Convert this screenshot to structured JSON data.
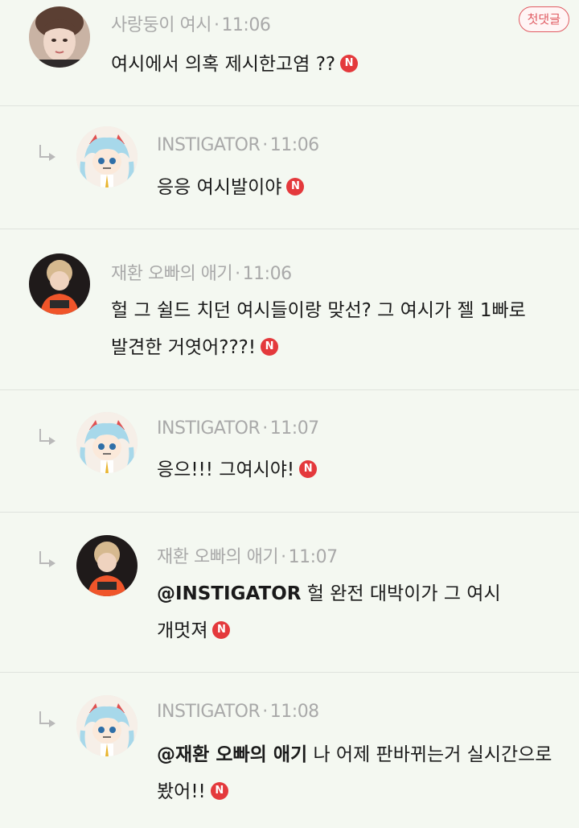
{
  "comments": [
    {
      "author": "사랑둥이 여시",
      "time": "11:06",
      "avatar": "photo-avatar-person",
      "badge": "첫댓글",
      "lines": [
        "여시에서 의혹 제시한고염 ??"
      ],
      "new_badge": "N"
    },
    {
      "author": "INSTIGATOR",
      "time": "11:06",
      "avatar": "cartoon-star-avatar",
      "lines": [
        "응응 여시발이야"
      ],
      "new_badge": "N"
    },
    {
      "author": "재환 오빠의 애기",
      "time": "11:06",
      "avatar": "photo-avatar-orange-shirt",
      "lines": [
        "헐 그 쉴드 치던 여시들이랑 맞선? 그 여시가 젤 1빠로",
        "발견한 거엿어???!"
      ],
      "new_badge": "N"
    },
    {
      "author": "INSTIGATOR",
      "time": "11:07",
      "avatar": "cartoon-star-avatar",
      "lines": [
        "응으!!! 그여시야!"
      ],
      "new_badge": "N"
    },
    {
      "author": "재환 오빠의 애기",
      "time": "11:07",
      "avatar": "photo-avatar-orange-shirt",
      "mention": "@INSTIGATOR",
      "lines": [
        " 헐 완전 대박이가 그 여시",
        "개멋져"
      ],
      "new_badge": "N"
    },
    {
      "author": "INSTIGATOR",
      "time": "11:08",
      "avatar": "cartoon-star-avatar",
      "mention": "@재환 오빠의 애기",
      "lines": [
        " 나 어제 판바뀌는거 실시간으로",
        "봤어!!"
      ],
      "new_badge": "N"
    }
  ],
  "colors": {
    "background": "#f4f8f1",
    "meta_text": "#a9a9a9",
    "new_badge": "#e4393c",
    "first_badge": "#e05a61",
    "divider": "#dfe3dd"
  }
}
